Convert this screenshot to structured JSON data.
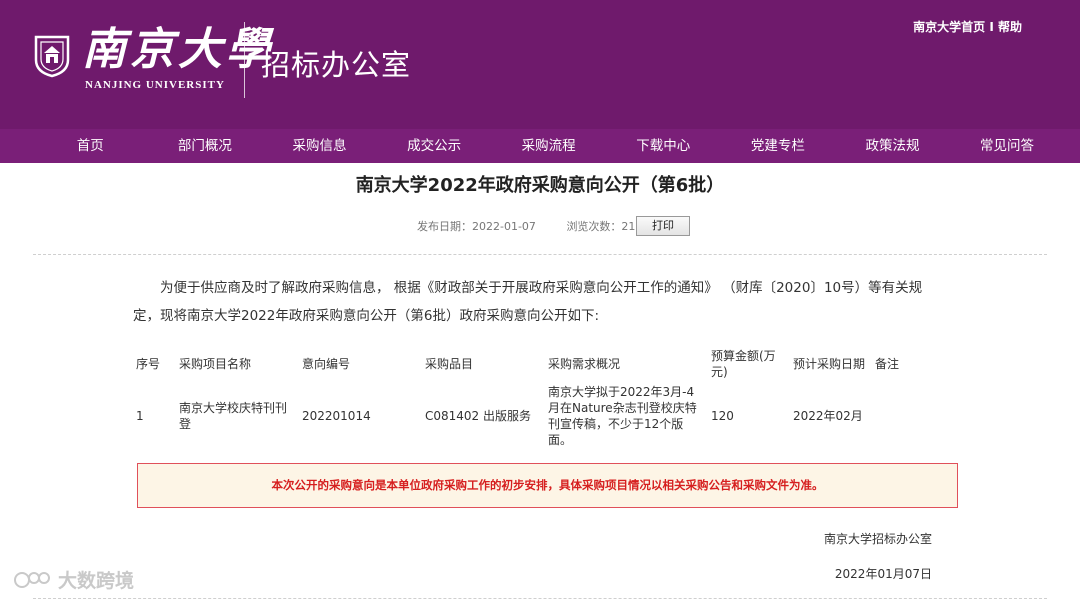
{
  "header": {
    "logo_cn": "南京大學",
    "logo_en": "NANJING UNIVERSITY",
    "office_title": "招标办公室",
    "top_links": [
      "南京大学首页",
      "帮助"
    ]
  },
  "nav": {
    "items": [
      "首页",
      "部门概况",
      "采购信息",
      "成交公示",
      "采购流程",
      "下载中心",
      "党建专栏",
      "政策法规",
      "常见问答"
    ]
  },
  "article": {
    "title": "南京大学2022年政府采购意向公开（第6批）",
    "publish_label": "发布日期：2022-01-07",
    "views_label": "浏览次数：212",
    "print_label": "打印",
    "intro_line1": "为便于供应商及时了解政府采购信息， 根据《财政部关于开展政府采购意向公开工作的通知》 （财库〔2020〕10号）等有关规",
    "intro_line2": "定，现将南京大学2022年政府采购意向公开（第6批）政府采购意向公开如下:"
  },
  "table": {
    "headers": [
      "序号",
      "采购项目名称",
      "意向编号",
      "采购品目",
      "采购需求概况",
      "预算金额(万元)",
      "预计采购日期",
      "备注"
    ],
    "rows": [
      [
        "1",
        "南京大学校庆特刊刊登",
        "202201014",
        "C081402 出版服务",
        "南京大学拟于2022年3月-4月在Nature杂志刊登校庆特刊宣传稿，不少于12个版面。",
        "120",
        "2022年02月",
        ""
      ]
    ]
  },
  "notice": "本次公开的采购意向是本单位政府采购工作的初步安排，具体采购项目情况以相关采购公告和采购文件为准。",
  "signature": {
    "org": "南京大学招标办公室",
    "date": "2022年01月07日"
  },
  "watermark": "大数跨境",
  "colors": {
    "header_bg": "#6f1a6c",
    "nav_bg": "#7a1f78",
    "notice_text": "#d61f1f",
    "notice_border": "#e0505a",
    "notice_bg": "#fdf5e6"
  }
}
